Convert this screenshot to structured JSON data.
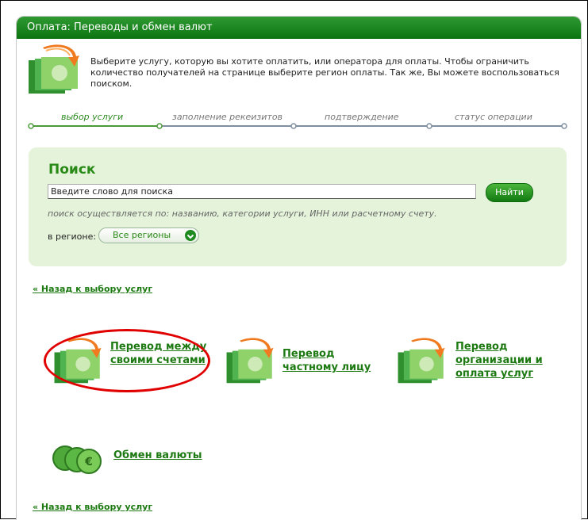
{
  "window": {
    "title": "Оплата: Переводы и обмен валют"
  },
  "intro": {
    "text": "Выберите услугу, которую вы хотите оплатить, или оператора для оплаты. Чтобы ограничить количество получателей на странице выберите регион оплаты. Так же, Вы можете воспользоваться поиском."
  },
  "steps": [
    {
      "label": "выбор услуги",
      "active": true
    },
    {
      "label": "заполнение рекеизитов",
      "active": false
    },
    {
      "label": "подтверждение",
      "active": false
    },
    {
      "label": "статус операции",
      "active": false
    }
  ],
  "search": {
    "title": "Поиск",
    "input_value": "Введите слово для поиска",
    "button_label": "Найти",
    "hint": "поиск осуществляется по: названию, категории услуги, ИНН или расчетному счету.",
    "region_label": "в регионе:",
    "region_value": "Все регионы"
  },
  "links": {
    "back": "« Назад к выбору услуг"
  },
  "services": [
    {
      "name": "service-transfer-own",
      "label": "Перевод между своими счетами",
      "icon": "money-transfer-icon"
    },
    {
      "name": "service-transfer-person",
      "label": "Перевод частному лицу",
      "icon": "money-transfer-icon"
    },
    {
      "name": "service-transfer-org",
      "label": "Перевод организации и оплата услуг",
      "icon": "money-transfer-icon"
    },
    {
      "name": "service-currency-exchange",
      "label": "Обмен валюты",
      "icon": "coins-icon"
    }
  ],
  "colors": {
    "accent": "#1d7a12",
    "titlebar": "#117a14",
    "highlight": "#e00000",
    "search_bg": "#e4f3d9"
  }
}
